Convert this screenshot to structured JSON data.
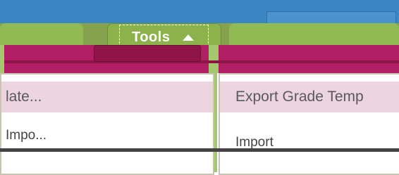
{
  "top_bar": {},
  "tabs": [
    {
      "label": ""
    },
    {
      "label": "Tools"
    },
    {
      "label": ""
    }
  ],
  "left_panel": {
    "header": "late...",
    "item": "Impo..."
  },
  "right_panel": {
    "header": "Export Grade Temp",
    "item": "Import"
  },
  "colors": {
    "top_bar": "#3c86c4",
    "tab_green": "#92ba53",
    "magenta_band": "#b01e63",
    "panel_header": "#ecd4e0"
  },
  "icons": [
    "caret-up-icon"
  ]
}
